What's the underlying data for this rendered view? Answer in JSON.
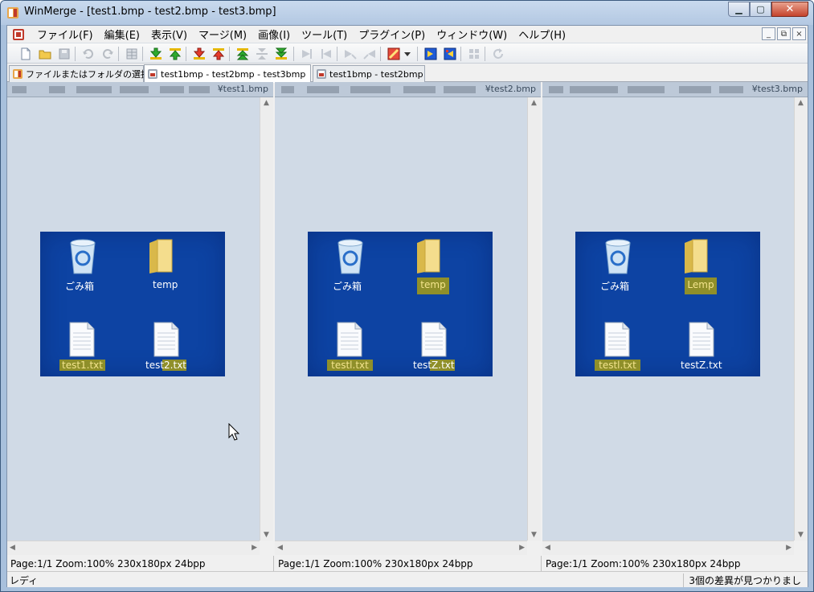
{
  "window": {
    "title": "WinMerge - [test1.bmp - test2.bmp - test3.bmp]",
    "controls": [
      "minimize",
      "maximize",
      "close"
    ]
  },
  "menubar": {
    "items": [
      "ファイル(F)",
      "編集(E)",
      "表示(V)",
      "マージ(M)",
      "画像(I)",
      "ツール(T)",
      "プラグイン(P)",
      "ウィンドウ(W)",
      "ヘルプ(H)"
    ],
    "mdi_controls": [
      "_",
      "⧉",
      "×"
    ]
  },
  "toolbar": {
    "buttons": [
      "new-icon",
      "open-icon",
      "save-icon",
      "undo-icon",
      "redo-icon",
      "options-icon",
      "next-diff-icon",
      "prev-diff-icon",
      "next-conflict-icon",
      "prev-conflict-icon",
      "first-diff-icon",
      "current-diff-icon",
      "last-diff-icon",
      "copy-right-icon",
      "copy-left-icon",
      "copy-right-advance-icon",
      "copy-left-advance-icon",
      "filter-icon",
      "dropdown-icon",
      "copy-all-right-icon",
      "copy-all-left-icon",
      "compare-icon",
      "refresh-icon"
    ]
  },
  "tabs": [
    {
      "label": "ファイルまたはフォルダの選択...",
      "active": false
    },
    {
      "label": "test1bmp - test2bmp - test3bmp",
      "active": true
    },
    {
      "label": "test1bmp - test2bmp",
      "active": false
    }
  ],
  "panes": [
    {
      "path": "¥test1.bmp",
      "status": "Page:1/1 Zoom:100% 230x180px 24bpp",
      "labels": {
        "bin": "ごみ箱",
        "folder": "temp",
        "file1": "test1.txt",
        "file2": "test2.txt"
      }
    },
    {
      "path": "¥test2.bmp",
      "status": "Page:1/1 Zoom:100% 230x180px 24bpp",
      "labels": {
        "bin": "ごみ箱",
        "folder": "temp",
        "file1": "testl.txt",
        "file2": "testZ.txt"
      }
    },
    {
      "path": "¥test3.bmp",
      "status": "Page:1/1 Zoom:100% 230x180px 24bpp",
      "labels": {
        "bin": "ごみ箱",
        "folder": "Lemp",
        "file1": "testl.txt",
        "file2": "testZ.txt"
      }
    }
  ],
  "statusbar": {
    "left": "レディ",
    "right": "3個の差異が見つかりまし"
  },
  "colors": {
    "desktop": "#0d43a3",
    "diff_highlight": "#8f8f2a",
    "pane_background": "#d0dae6"
  }
}
